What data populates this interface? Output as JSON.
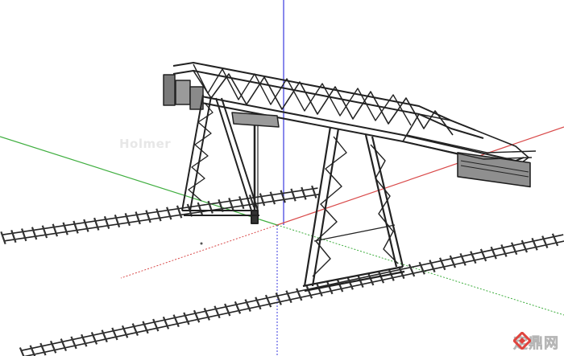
{
  "viewport": {
    "background": "#ffffff",
    "axes": {
      "red_axis_color": "#d94a4a",
      "green_axis_color": "#3fae3f",
      "blue_axis_color": "#3a3adf"
    },
    "model": {
      "icon": "gantry-crane-icon",
      "stroke_color": "#222222",
      "fill_color": "#9a9a9a"
    }
  },
  "watermark": {
    "center_text": "Holmer",
    "corner_text": "定鼎网",
    "corner_icon": "diamond-logo-icon",
    "corner_logo_color": "#e0443e"
  }
}
